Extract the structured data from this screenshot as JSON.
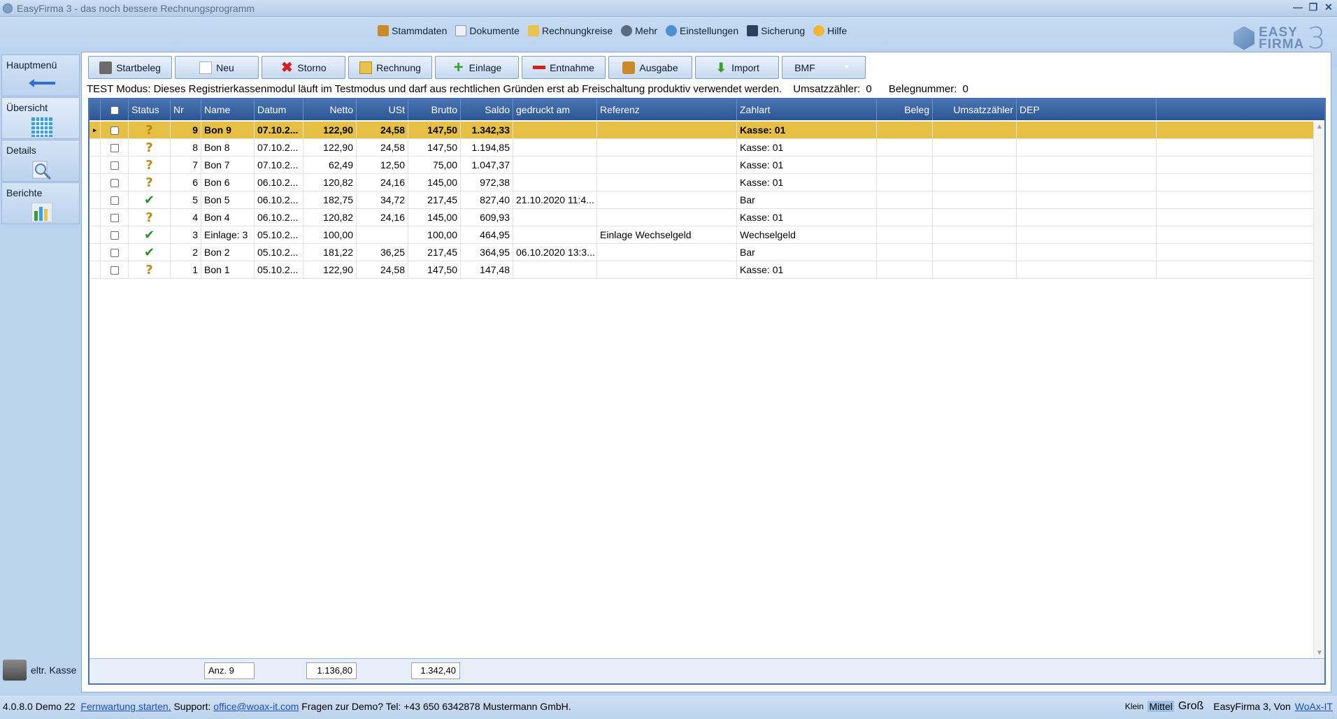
{
  "window": {
    "title": "EasyFirma 3 - das noch bessere Rechnungsprogramm",
    "controls": [
      "—",
      "❐",
      "✕"
    ]
  },
  "menu": [
    {
      "label": "Stammdaten",
      "icon": "stammdaten-icon",
      "color": "#c98a2b"
    },
    {
      "label": "Dokumente",
      "icon": "document-icon",
      "color": "#e9eef5"
    },
    {
      "label": "Rechnungkreise",
      "icon": "invoice-circle-icon",
      "color": "#e8c24a"
    },
    {
      "label": "Mehr",
      "icon": "more-icon",
      "color": "#5a6b82"
    },
    {
      "label": "Einstellungen",
      "icon": "gear-icon",
      "color": "#4e8fd1"
    },
    {
      "label": "Sicherung",
      "icon": "save-disk-icon",
      "color": "#2f3f5f"
    },
    {
      "label": "Hilfe",
      "icon": "help-icon",
      "color": "#f0b63a"
    }
  ],
  "logo": {
    "line1": "EASY",
    "line2": "FIRMA",
    "num": "3"
  },
  "sidebar": [
    {
      "label": "Hauptmenü",
      "icon": "arrow-left-icon"
    },
    {
      "label": "Übersicht",
      "icon": "grid-icon"
    },
    {
      "label": "Details",
      "icon": "magnifier-icon"
    },
    {
      "label": "Berichte",
      "icon": "report-chart-icon"
    }
  ],
  "toolbar": [
    {
      "label": "Startbeleg",
      "icon": "register-icon",
      "color": "#6b6b6b"
    },
    {
      "label": "Neu",
      "icon": "new-doc-icon",
      "color": "#ffffff"
    },
    {
      "label": "Storno",
      "icon": "storno-x-icon",
      "color": "#d62020"
    },
    {
      "label": "Rechnung",
      "icon": "invoice-icon",
      "color": "#e8c24a"
    },
    {
      "label": "Einlage",
      "icon": "plus-icon",
      "color": "#3aa02a"
    },
    {
      "label": "Entnahme",
      "icon": "minus-icon",
      "color": "#d62020"
    },
    {
      "label": "Ausgabe",
      "icon": "expense-icon",
      "color": "#c98a2b"
    },
    {
      "label": "Import",
      "icon": "import-icon",
      "color": "#3aa02a"
    },
    {
      "label": "BMF",
      "icon": "dropdown-arrow-icon",
      "color": "#ffffff"
    }
  ],
  "info": {
    "test_mode": "TEST Modus: Dieses Registrierkassenmodul läuft im Testmodus und darf aus rechtlichen Gründen erst ab Freischaltung produktiv verwendet werden.",
    "umsatz_label": "Umsatzzähler:",
    "umsatz_value": "0",
    "beleg_label": "Belegnummer:",
    "beleg_value": "0"
  },
  "columns": [
    "Status",
    "Nr",
    "Name",
    "Datum",
    "Netto",
    "USt",
    "Brutto",
    "Saldo",
    "gedruckt am",
    "Referenz",
    "Zahlart",
    "Beleg",
    "Umsatzzähler",
    "DEP"
  ],
  "rows": [
    {
      "status": "?",
      "nr": "9",
      "name": "Bon 9",
      "datum": "07.10.2...",
      "netto": "122,90",
      "ust": "24,58",
      "brutto": "147,50",
      "saldo": "1.342,33",
      "gedruckt": "",
      "referenz": "",
      "zahlart": "Kasse: 01",
      "selected": true
    },
    {
      "status": "?",
      "nr": "8",
      "name": "Bon 8",
      "datum": "07.10.2...",
      "netto": "122,90",
      "ust": "24,58",
      "brutto": "147,50",
      "saldo": "1.194,85",
      "gedruckt": "",
      "referenz": "",
      "zahlart": "Kasse: 01"
    },
    {
      "status": "?",
      "nr": "7",
      "name": "Bon 7",
      "datum": "07.10.2...",
      "netto": "62,49",
      "ust": "12,50",
      "brutto": "75,00",
      "saldo": "1.047,37",
      "gedruckt": "",
      "referenz": "",
      "zahlart": "Kasse: 01"
    },
    {
      "status": "?",
      "nr": "6",
      "name": "Bon 6",
      "datum": "06.10.2...",
      "netto": "120,82",
      "ust": "24,16",
      "brutto": "145,00",
      "saldo": "972,38",
      "gedruckt": "",
      "referenz": "",
      "zahlart": "Kasse: 01"
    },
    {
      "status": "ok",
      "nr": "5",
      "name": "Bon 5",
      "datum": "06.10.2...",
      "netto": "182,75",
      "ust": "34,72",
      "brutto": "217,45",
      "saldo": "827,40",
      "gedruckt": "21.10.2020 11:4...",
      "referenz": "",
      "zahlart": "Bar"
    },
    {
      "status": "?",
      "nr": "4",
      "name": "Bon 4",
      "datum": "06.10.2...",
      "netto": "120,82",
      "ust": "24,16",
      "brutto": "145,00",
      "saldo": "609,93",
      "gedruckt": "",
      "referenz": "",
      "zahlart": "Kasse: 01"
    },
    {
      "status": "ok",
      "nr": "3",
      "name": "Einlage: 3",
      "datum": "05.10.2...",
      "netto": "100,00",
      "ust": "",
      "brutto": "100,00",
      "saldo": "464,95",
      "gedruckt": "",
      "referenz": "Einlage Wechselgeld",
      "zahlart": "Wechselgeld"
    },
    {
      "status": "ok",
      "nr": "2",
      "name": "Bon 2",
      "datum": "05.10.2...",
      "netto": "181,22",
      "ust": "36,25",
      "brutto": "217,45",
      "saldo": "364,95",
      "gedruckt": "06.10.2020 13:3...",
      "referenz": "",
      "zahlart": "Bar"
    },
    {
      "status": "?",
      "nr": "1",
      "name": "Bon 1",
      "datum": "05.10.2...",
      "netto": "122,90",
      "ust": "24,58",
      "brutto": "147,50",
      "saldo": "147,48",
      "gedruckt": "",
      "referenz": "",
      "zahlart": "Kasse: 01"
    }
  ],
  "summary": {
    "count": "Anz. 9",
    "netto_sum": "1.136,80",
    "brutto_sum": "1.342,40"
  },
  "kasse": {
    "label": "eltr. Kasse"
  },
  "status": {
    "version": "4.0.8.0 Demo 22",
    "fernwartung": "Fernwartung starten.",
    "support_label": "Support:",
    "email": "office@woax-it.com",
    "demo_text": "Fragen zur Demo? Tel: +43 650 6342878 Mustermann GmbH.",
    "size_small": "Klein",
    "size_medium": "Mittel",
    "size_large": "Groß",
    "by": "EasyFirma 3, Von",
    "by_link": "WoAx-IT"
  }
}
